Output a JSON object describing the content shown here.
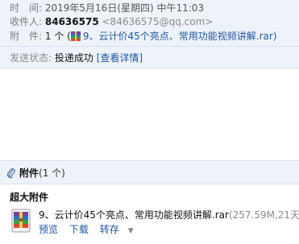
{
  "header": {
    "time_label": "时　间:",
    "time_value": "2019年5月16日(星期四) 中午11:03",
    "recipient_label": "收件人:",
    "recipient_name": "84636575",
    "recipient_email": "<84636575@qq.com>",
    "attachment_label": "附　件:",
    "attachment_count": "1 个",
    "attachment_open": "(",
    "attachment_file": "9、云计价45个亮点、常用功能视频讲解.rar)"
  },
  "status": {
    "label": "发送状态:",
    "value": "投递成功",
    "link": "[查看详情]"
  },
  "attachments": {
    "title": "附件",
    "count": "(1 个)",
    "super_label": "超大附件",
    "file_name": "9、云计价45个亮点、常用功能视频讲解.rar",
    "file_size": "(257.59M,21天",
    "actions": {
      "preview": "预览",
      "download": "下载",
      "forward": "转存",
      "caret": "▼"
    }
  },
  "icons": {
    "rar": "winrar-archive-icon",
    "clip": "paperclip-icon"
  },
  "colors": {
    "link": "#1f56a3",
    "header_bg": "#eef3f9"
  }
}
